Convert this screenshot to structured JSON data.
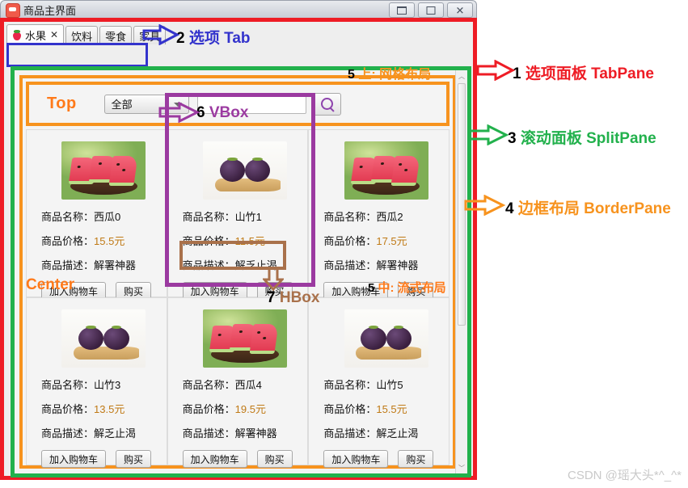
{
  "window": {
    "title": "商品主界面",
    "app_icon": "app-icon",
    "controls": [
      {
        "name": "minimize-button",
        "glyph": ""
      },
      {
        "name": "maximize-button",
        "glyph": ""
      },
      {
        "name": "close-button",
        "glyph": "✕"
      }
    ]
  },
  "tabs": [
    {
      "label": "水果",
      "active": true,
      "icon": "strawberry-icon",
      "close": "✕"
    },
    {
      "label": "饮料",
      "active": false
    },
    {
      "label": "零食",
      "active": false
    },
    {
      "label": "家具",
      "active": false
    }
  ],
  "top": {
    "region_label": "Top",
    "category_select": {
      "value": "全部",
      "caret": "▼"
    },
    "search_input": {
      "value": "",
      "placeholder": ""
    },
    "search_button_icon": "magnifier-icon"
  },
  "center": {
    "region_label": "Center",
    "labels": {
      "name_prefix": "商品名称：",
      "price_prefix": "商品价格：",
      "desc_prefix": "商品描述："
    },
    "buttons": {
      "cart": "加入购物车",
      "buy": "购买"
    },
    "products": [
      {
        "name": "西瓜0",
        "price": "15.5元",
        "desc": "解署神器",
        "image": "watermelon-photo"
      },
      {
        "name": "山竹1",
        "price": "11.5元",
        "desc": "解乏止渴",
        "image": "mangosteen-photo"
      },
      {
        "name": "西瓜2",
        "price": "17.5元",
        "desc": "解署神器",
        "image": "watermelon-photo"
      },
      {
        "name": "山竹3",
        "price": "13.5元",
        "desc": "解乏止渴",
        "image": "mangosteen-photo"
      },
      {
        "name": "西瓜4",
        "price": "19.5元",
        "desc": "解署神器",
        "image": "watermelon-photo"
      },
      {
        "name": "山竹5",
        "price": "15.5元",
        "desc": "解乏止渴",
        "image": "mangosteen-photo"
      }
    ]
  },
  "scrollbar": {
    "up": "︿",
    "down": "﹀"
  },
  "annotations": {
    "tabpane": {
      "num": "1",
      "text": " 选项面板 TabPane",
      "color": "#ee1c25"
    },
    "tab": {
      "num": "2",
      "text": " 选项 Tab",
      "color": "#3333cc"
    },
    "splitpane": {
      "num": "3",
      "text": " 滚动面板 SplitPane",
      "color": "#22b14c"
    },
    "borderpane": {
      "num": "4",
      "text": " 边框布局 BorderPane",
      "color": "#f7931e"
    },
    "grid_top": {
      "num": "5",
      "text": " 上: 网格布局",
      "color": "#f7931e"
    },
    "flow_center": {
      "num": "5",
      "text": " 中: 流式布局",
      "color": "#f7931e"
    },
    "vbox": {
      "num": "6",
      "text": " VBox",
      "color": "#9b3aa0"
    },
    "hbox": {
      "num": "7",
      "text": " HBox",
      "color": "#a9714b"
    }
  },
  "watermark": "CSDN @瑶大头*^_^*"
}
